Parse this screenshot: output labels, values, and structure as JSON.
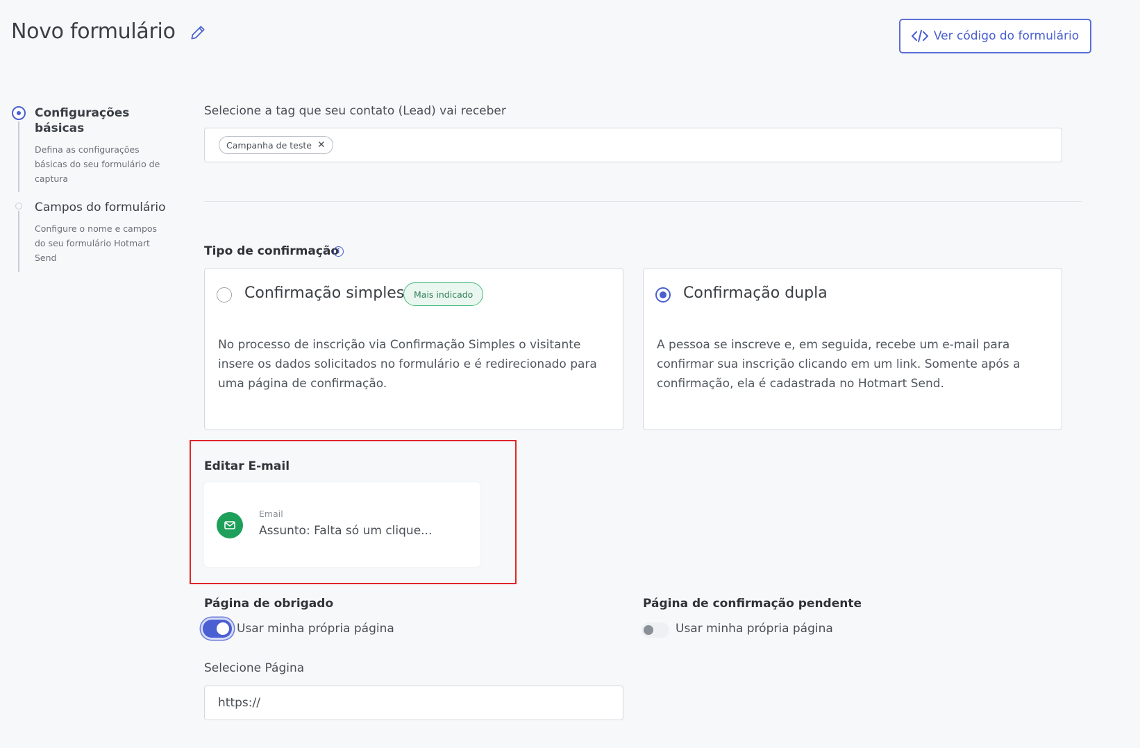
{
  "header": {
    "title": "Novo formulário",
    "code_button_label": "Ver código do formulário"
  },
  "stepper": {
    "steps": [
      {
        "title": "Configurações básicas",
        "description": "Defina as configurações básicas do seu formulário de captura",
        "active": true
      },
      {
        "title": "Campos do formulário",
        "description": "Configure o nome e campos do seu formulário Hotmart Send",
        "active": false
      }
    ]
  },
  "tag_section": {
    "label": "Selecione a tag que seu contato (Lead) vai receber",
    "tags": [
      "Campanha de teste"
    ]
  },
  "confirmation": {
    "label": "Tipo de confirmação",
    "options": [
      {
        "title": "Confirmação simples",
        "badge": "Mais indicado",
        "selected": false,
        "description": "No processo de inscrição via Confirmação Simples o visitante insere os dados solicitados no formulário e é redirecionado para uma página de confirmação."
      },
      {
        "title": "Confirmação dupla",
        "selected": true,
        "description": "A pessoa se inscreve e, em seguida, recebe um e-mail para confirmar sua inscrição clicando em um link. Somente após a confirmação, ela é cadastrada no Hotmart Send."
      }
    ]
  },
  "edit_email": {
    "label": "Editar E-mail",
    "kicker": "Email",
    "subject": "Assunto: Falta só um clique..."
  },
  "thank_you_page": {
    "label": "Página de obrigado",
    "toggle_label": "Usar minha própria página",
    "enabled": true
  },
  "pending_page": {
    "label": "Página de confirmação pendente",
    "toggle_label": "Usar minha própria página",
    "enabled": false
  },
  "select_page": {
    "label": "Selecione Página",
    "value": "https://"
  },
  "colors": {
    "accent": "#4a5fd1",
    "success": "#1ea05a",
    "highlight": "#e0262a"
  }
}
